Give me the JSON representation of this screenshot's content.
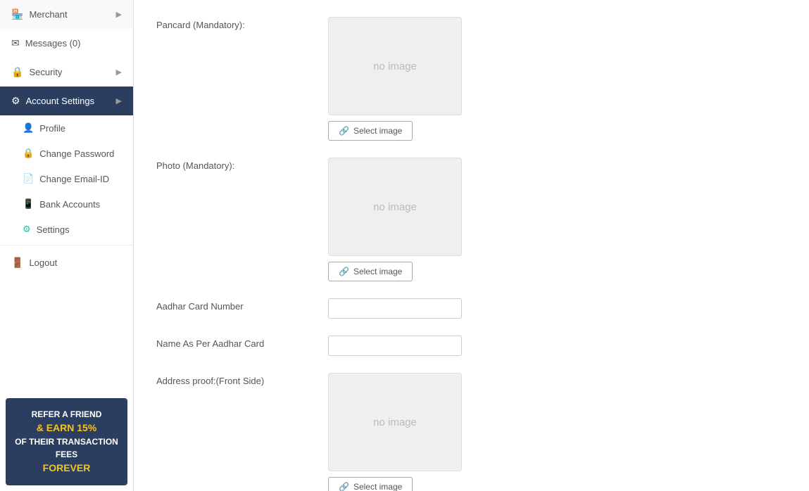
{
  "sidebar": {
    "items": [
      {
        "id": "merchant",
        "label": "Merchant",
        "icon": "🏪",
        "hasArrow": true
      },
      {
        "id": "messages",
        "label": "Messages (0)",
        "icon": "✉"
      },
      {
        "id": "security",
        "label": "Security",
        "icon": "🔒",
        "hasArrow": true
      },
      {
        "id": "account-settings",
        "label": "Account Settings",
        "icon": "⚙",
        "hasArrow": true,
        "active": true
      }
    ],
    "sub_items": [
      {
        "id": "profile",
        "label": "Profile",
        "icon": "👤"
      },
      {
        "id": "change-password",
        "label": "Change Password",
        "icon": "🔒"
      },
      {
        "id": "change-email",
        "label": "Change Email-ID",
        "icon": "📄"
      },
      {
        "id": "bank-accounts",
        "label": "Bank Accounts",
        "icon": "📱"
      },
      {
        "id": "settings",
        "label": "Settings",
        "icon": "⚙"
      }
    ],
    "logout": {
      "label": "Logout",
      "icon": "🚪"
    }
  },
  "refer_banner": {
    "line1": "REFER A FRIEND",
    "line2": "& EARN 15%",
    "line3": "OF THEIR TRANSACTION FEES",
    "line4": "FOREVER"
  },
  "form": {
    "fields": [
      {
        "id": "pancard",
        "label": "Pancard (Mandatory):",
        "type": "image",
        "placeholder": "no image"
      },
      {
        "id": "photo",
        "label": "Photo (Mandatory):",
        "type": "image",
        "placeholder": "no image"
      },
      {
        "id": "aadhar-number",
        "label": "Aadhar Card Number",
        "type": "text",
        "value": "",
        "placeholder": ""
      },
      {
        "id": "aadhar-name",
        "label": "Name As Per Aadhar Card",
        "type": "text",
        "value": "",
        "placeholder": ""
      },
      {
        "id": "address-proof",
        "label": "Address proof:(Front Side)",
        "type": "image",
        "placeholder": "no image"
      }
    ],
    "select_image_label": "Select image"
  }
}
